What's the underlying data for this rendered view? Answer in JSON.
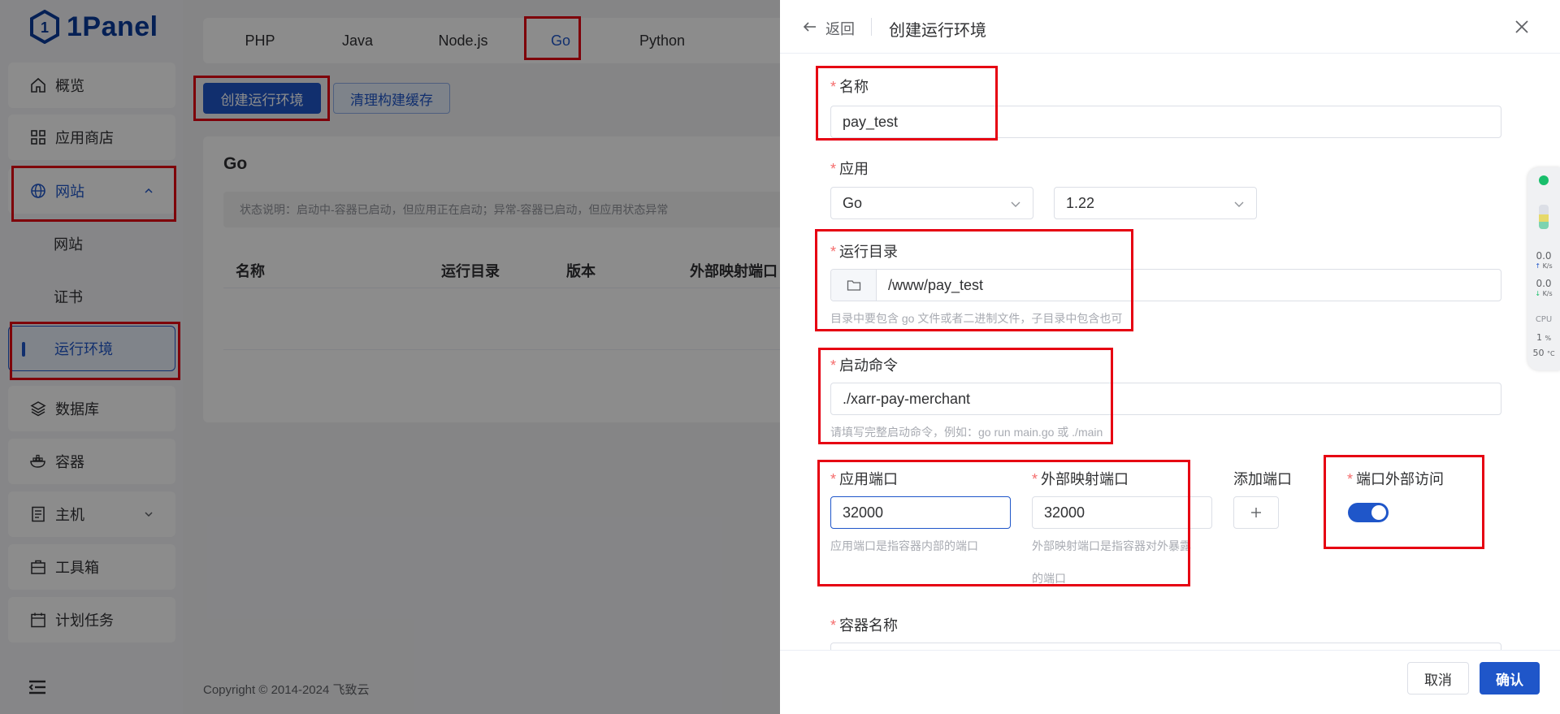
{
  "app": {
    "logo_text": "1Panel"
  },
  "sidebar": {
    "items": [
      {
        "label": "概览",
        "icon": "home-icon"
      },
      {
        "label": "应用商店",
        "icon": "apps-icon"
      },
      {
        "label": "网站",
        "icon": "globe-icon",
        "expanded": true
      },
      {
        "label": "数据库",
        "icon": "layers-icon"
      },
      {
        "label": "容器",
        "icon": "docker-icon"
      },
      {
        "label": "主机",
        "icon": "host-icon"
      },
      {
        "label": "工具箱",
        "icon": "toolbox-icon"
      },
      {
        "label": "计划任务",
        "icon": "calendar-icon"
      }
    ],
    "sub_items": [
      {
        "label": "网站"
      },
      {
        "label": "证书"
      },
      {
        "label": "运行环境",
        "active": true
      }
    ]
  },
  "main": {
    "tabs": [
      {
        "label": "PHP"
      },
      {
        "label": "Java"
      },
      {
        "label": "Node.js"
      },
      {
        "label": "Go",
        "active": true
      },
      {
        "label": "Python"
      }
    ],
    "create_button": "创建运行环境",
    "clear_cache_button": "清理构建缓存",
    "section_title": "Go",
    "status_note": "状态说明：启动中-容器已启动，但应用正在启动；异常-容器已启动，但应用状态异常",
    "table_headers": [
      "名称",
      "运行目录",
      "版本",
      "外部映射端口"
    ],
    "footer": "Copyright © 2014-2024 飞致云"
  },
  "drawer": {
    "back_label": "返回",
    "title": "创建运行环境",
    "fields": {
      "name": {
        "label": "名称",
        "value": "pay_test"
      },
      "app": {
        "label": "应用",
        "app_value": "Go",
        "version_value": "1.22"
      },
      "run_dir": {
        "label": "运行目录",
        "value": "/www/pay_test",
        "hint": "目录中要包含 go 文件或者二进制文件，子目录中包含也可"
      },
      "start_cmd": {
        "label": "启动命令",
        "value": "./xarr-pay-merchant",
        "hint": "请填写完整启动命令，例如：go run main.go 或 ./main"
      },
      "app_port": {
        "label": "应用端口",
        "value": "32000",
        "hint": "应用端口是指容器内部的端口"
      },
      "external_port": {
        "label": "外部映射端口",
        "value": "32000",
        "hint_line1": "外部映射端口是指容器对外暴露",
        "hint_line2": "的端口"
      },
      "add_port": {
        "label": "添加端口"
      },
      "port_external_access": {
        "label": "端口外部访问",
        "enabled": true
      },
      "container_name": {
        "label": "容器名称"
      }
    },
    "cancel_button": "取消",
    "confirm_button": "确认"
  },
  "monitor": {
    "up_value": "0.0",
    "down_value": "0.0",
    "rate_unit": "K/s",
    "cpu_label": "CPU",
    "cpu_value": "1",
    "cpu_unit": "%",
    "temp_value": "50",
    "temp_unit": "°C"
  },
  "colors": {
    "accent": "#1f56c9",
    "highlight_box": "#e60012",
    "required": "#f56c6c",
    "status_ok": "#19be6b"
  }
}
